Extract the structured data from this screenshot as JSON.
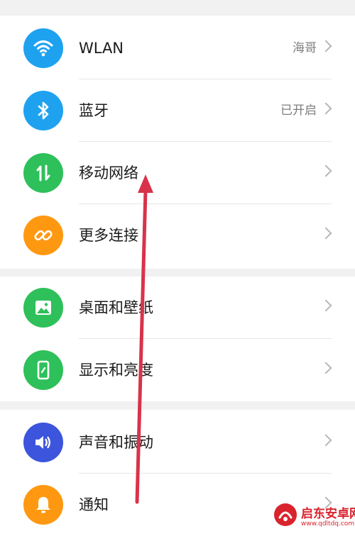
{
  "group1": {
    "items": [
      {
        "label": "WLAN",
        "value": "海哥",
        "icon": "wifi-icon",
        "color": "#1ea2f0"
      },
      {
        "label": "蓝牙",
        "value": "已开启",
        "icon": "bluetooth-icon",
        "color": "#1ea2f0"
      },
      {
        "label": "移动网络",
        "value": "",
        "icon": "mobile-data-icon",
        "color": "#2ec05a"
      },
      {
        "label": "更多连接",
        "value": "",
        "icon": "link-icon",
        "color": "#ff9811"
      }
    ]
  },
  "group2": {
    "items": [
      {
        "label": "桌面和壁纸",
        "value": "",
        "icon": "image-icon",
        "color": "#2ec05a"
      },
      {
        "label": "显示和亮度",
        "value": "",
        "icon": "phone-brightness-icon",
        "color": "#2ec05a"
      }
    ]
  },
  "group3": {
    "items": [
      {
        "label": "声音和振动",
        "value": "",
        "icon": "volume-icon",
        "color": "#3d55dd"
      },
      {
        "label": "通知",
        "value": "",
        "icon": "bell-icon",
        "color": "#ff9811"
      }
    ]
  },
  "watermark": {
    "title": "启东安卓网",
    "url": "www.qdltdq.com",
    "color": "#d9232d"
  },
  "annotation": {
    "arrow_color": "#d8334a"
  }
}
